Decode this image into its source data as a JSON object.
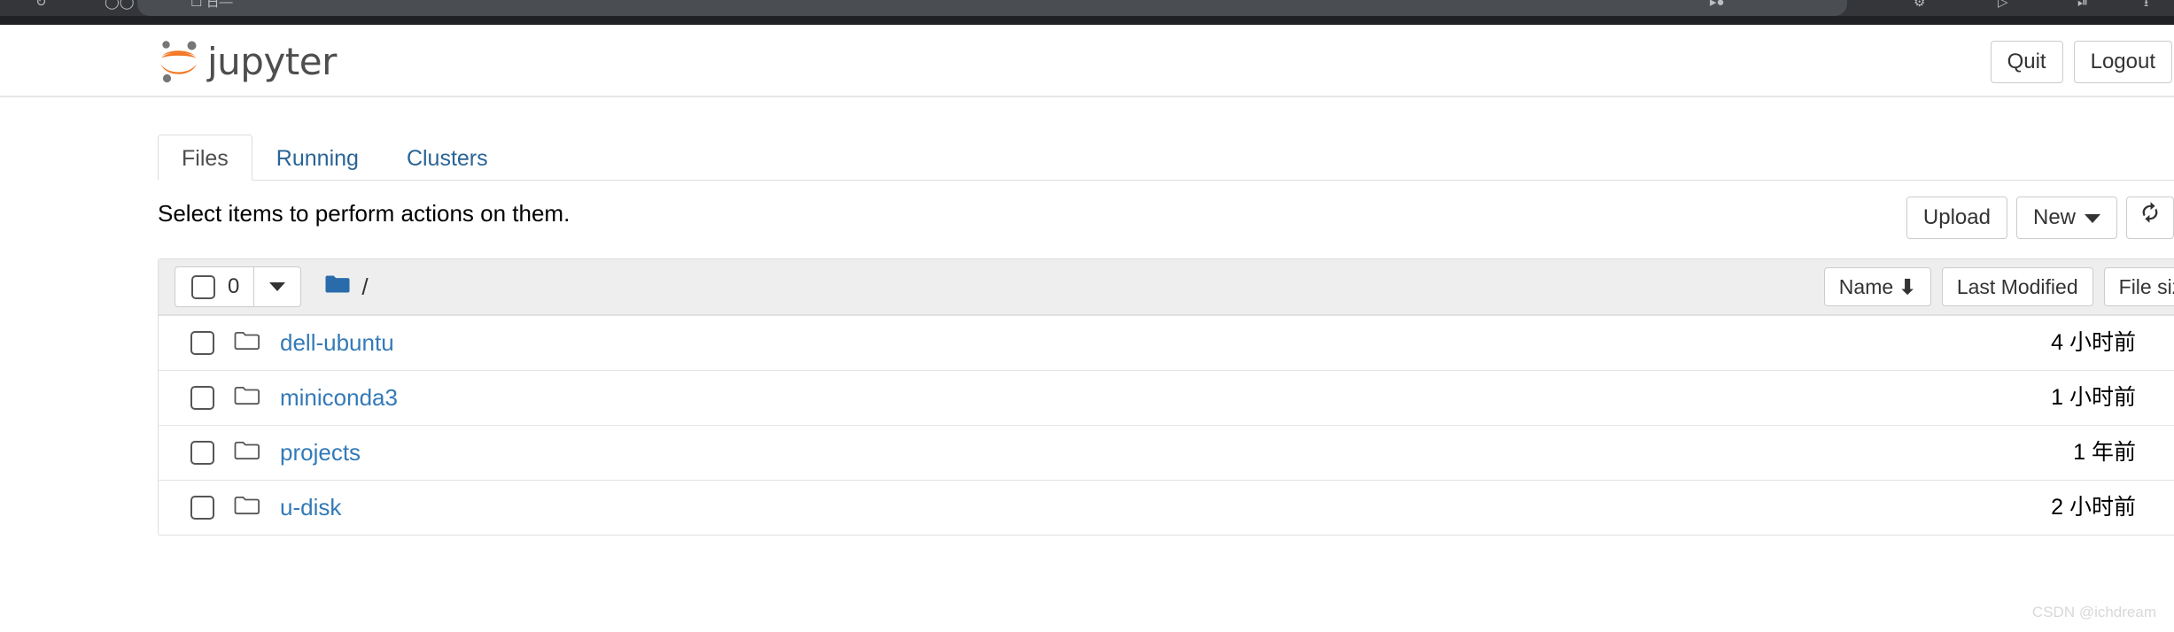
{
  "browser": {
    "tab_glyphs": "✕   ▷●        ⚙   |   ▷        ⬇   ⬇"
  },
  "header": {
    "logo_text": "jupyter",
    "logo_icon": "jupyter-logo-icon",
    "logo_color": "#F37726",
    "logo_dot_color": "#767677",
    "quit_label": "Quit",
    "logout_label": "Logout"
  },
  "tabs": [
    {
      "label": "Files",
      "active": true
    },
    {
      "label": "Running",
      "active": false
    },
    {
      "label": "Clusters",
      "active": false
    }
  ],
  "actions": {
    "hint_text": "Select items to perform actions on them.",
    "upload_label": "Upload",
    "new_label": "New",
    "refresh_icon": "refresh-icon"
  },
  "filelist": {
    "selected_count": "0",
    "breadcrumb_root": "/",
    "folder_icon": "folder-icon",
    "columns": [
      {
        "label": "Name",
        "sort_indicator": "⬇"
      },
      {
        "label": "Last Modified",
        "sort_indicator": ""
      },
      {
        "label": "File size",
        "sort_indicator": ""
      }
    ],
    "rows": [
      {
        "name": "dell-ubuntu",
        "modified": "4 小时前",
        "size": ""
      },
      {
        "name": "miniconda3",
        "modified": "1 小时前",
        "size": ""
      },
      {
        "name": "projects",
        "modified": "1 年前",
        "size": ""
      },
      {
        "name": "u-disk",
        "modified": "2 小时前",
        "size": ""
      }
    ]
  },
  "watermark": {
    "text": "CSDN @ichdream"
  },
  "colors": {
    "link": "#337ab7",
    "accent_orange": "#F37726",
    "folder_blue": "#2a6bab"
  }
}
